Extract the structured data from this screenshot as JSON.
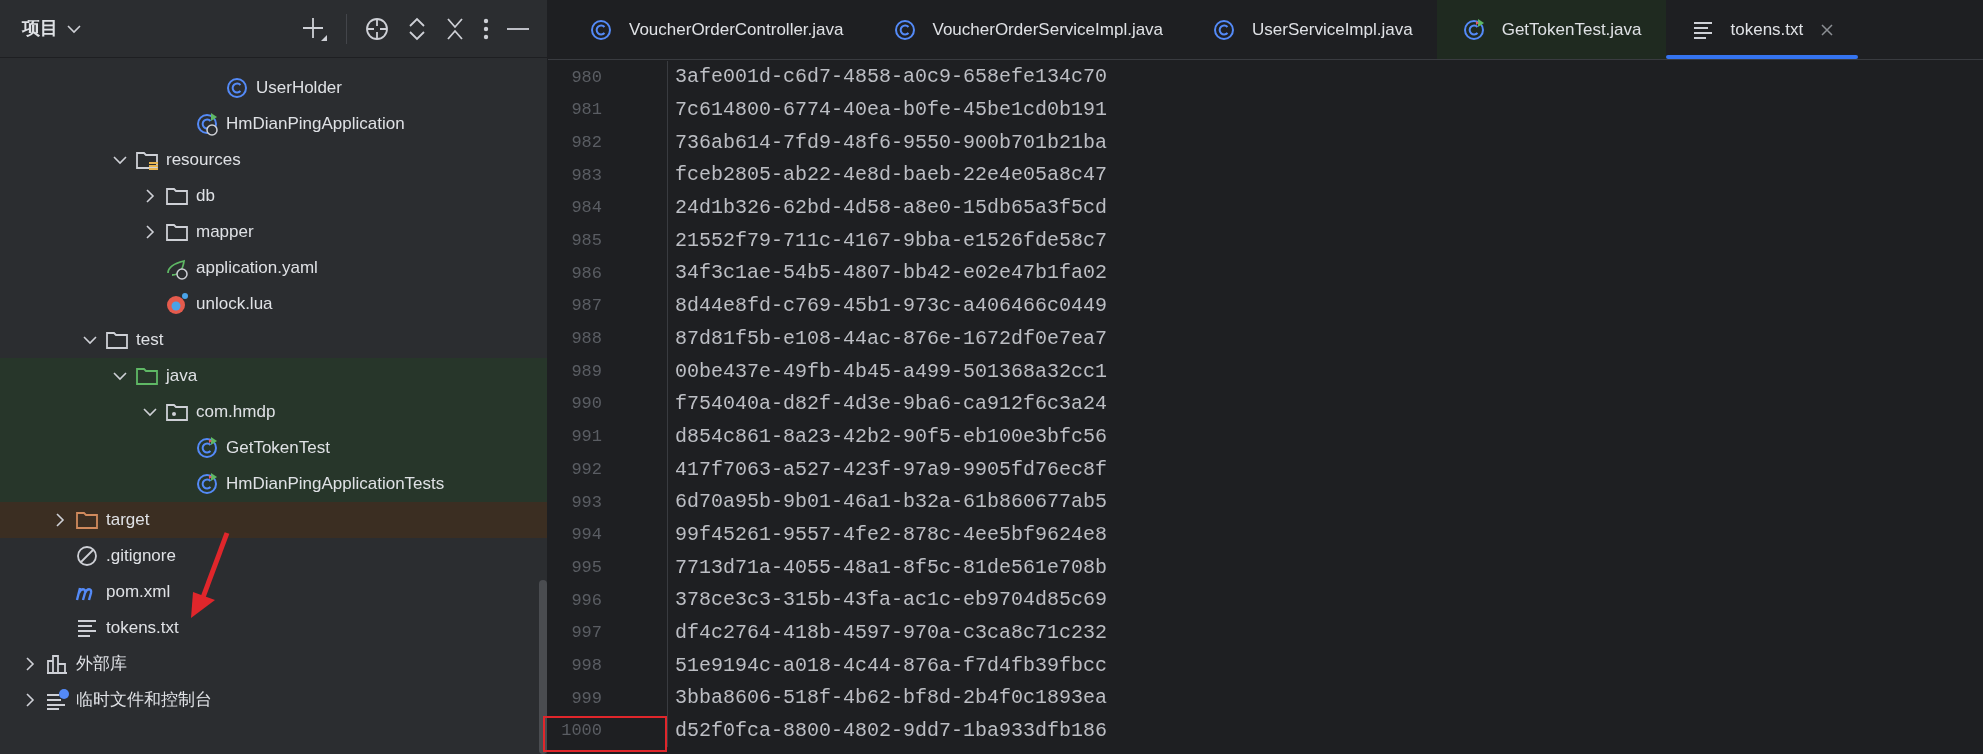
{
  "project_panel": {
    "title": "项目",
    "tree": [
      {
        "children": [
          {
            "children": [
              {
                "children": [
                  {
                    "children": [
                      {
                        "children": [
                          {
                            "children": [
                              {
                                "label": "UserHolder",
                                "kind": "class"
                              }
                            ]
                          },
                          {
                            "label": "HmDianPingApplication",
                            "kind": "app-class"
                          }
                        ]
                      }
                    ]
                  },
                  {
                    "label": "resources",
                    "kind": "resources-folder",
                    "expanded": true,
                    "children": [
                      {
                        "label": "db",
                        "kind": "folder",
                        "expanded": false
                      },
                      {
                        "label": "mapper",
                        "kind": "folder",
                        "expanded": false
                      },
                      {
                        "label": "application.yaml",
                        "kind": "yaml"
                      },
                      {
                        "label": "unlock.lua",
                        "kind": "lua"
                      }
                    ]
                  }
                ]
              },
              {
                "label": "test",
                "kind": "folder",
                "expanded": true,
                "children": [
                  {
                    "label": "java",
                    "kind": "test-folder",
                    "expanded": true,
                    "color": "#27362a",
                    "children": [
                      {
                        "label": "com.hmdp",
                        "kind": "package",
                        "expanded": true,
                        "color": "#27362a",
                        "children": [
                          {
                            "label": "GetTokenTest",
                            "kind": "test-class",
                            "color": "#27362a"
                          },
                          {
                            "label": "HmDianPingApplicationTests",
                            "kind": "test-class",
                            "color": "#27362a"
                          }
                        ]
                      }
                    ]
                  }
                ]
              }
            ]
          },
          {
            "label": "target",
            "kind": "excluded-folder",
            "expanded": false,
            "color": "#3b2e22"
          },
          {
            "label": ".gitignore",
            "kind": "gitignore"
          },
          {
            "label": "pom.xml",
            "kind": "maven"
          },
          {
            "label": "tokens.txt",
            "kind": "text"
          }
        ]
      },
      {
        "label": "外部库",
        "kind": "library",
        "expanded": false
      },
      {
        "label": "临时文件和控制台",
        "kind": "scratch",
        "expanded": false
      }
    ]
  },
  "tabs": [
    {
      "label": "VoucherOrderController.java",
      "kind": "class",
      "selected": false
    },
    {
      "label": "VoucherOrderServiceImpl.java",
      "kind": "class",
      "selected": false
    },
    {
      "label": "UserServiceImpl.java",
      "kind": "class",
      "selected": false
    },
    {
      "label": "GetTokenTest.java",
      "kind": "test-class",
      "selected": false
    },
    {
      "label": "tokens.txt",
      "kind": "text",
      "selected": true
    }
  ],
  "editor": {
    "lines": [
      {
        "number": "980",
        "text": "3afe001d-c6d7-4858-a0c9-658efe134c70"
      },
      {
        "number": "981",
        "text": "7c614800-6774-40ea-b0fe-45be1cd0b191"
      },
      {
        "number": "982",
        "text": "736ab614-7fd9-48f6-9550-900b701b21ba"
      },
      {
        "number": "983",
        "text": "fceb2805-ab22-4e8d-baeb-22e4e05a8c47"
      },
      {
        "number": "984",
        "text": "24d1b326-62bd-4d58-a8e0-15db65a3f5cd"
      },
      {
        "number": "985",
        "text": "21552f79-711c-4167-9bba-e1526fde58c7"
      },
      {
        "number": "986",
        "text": "34f3c1ae-54b5-4807-bb42-e02e47b1fa02"
      },
      {
        "number": "987",
        "text": "8d44e8fd-c769-45b1-973c-a406466c0449"
      },
      {
        "number": "988",
        "text": "87d81f5b-e108-44ac-876e-1672df0e7ea7"
      },
      {
        "number": "989",
        "text": "00be437e-49fb-4b45-a499-501368a32cc1"
      },
      {
        "number": "990",
        "text": "f754040a-d82f-4d3e-9ba6-ca912f6c3a24"
      },
      {
        "number": "991",
        "text": "d854c861-8a23-42b2-90f5-eb100e3bfc56"
      },
      {
        "number": "992",
        "text": "417f7063-a527-423f-97a9-9905fd76ec8f"
      },
      {
        "number": "993",
        "text": "6d70a95b-9b01-46a1-b32a-61b860677ab5"
      },
      {
        "number": "994",
        "text": "99f45261-9557-4fe2-878c-4ee5bf9624e8"
      },
      {
        "number": "995",
        "text": "7713d71a-4055-48a1-8f5c-81de561e708b"
      },
      {
        "number": "996",
        "text": "378ce3c3-315b-43fa-ac1c-eb9704d85c69"
      },
      {
        "number": "997",
        "text": "df4c2764-418b-4597-970a-c3ca8c71c232"
      },
      {
        "number": "998",
        "text": "51e9194c-a018-4c44-876a-f7d4fb39fbcc"
      },
      {
        "number": "999",
        "text": "3bba8606-518f-4b62-bf8d-2b4f0c1893ea"
      },
      {
        "number": "1000",
        "text": "d52f0fca-8800-4802-9dd7-1ba933dfb186"
      }
    ]
  }
}
